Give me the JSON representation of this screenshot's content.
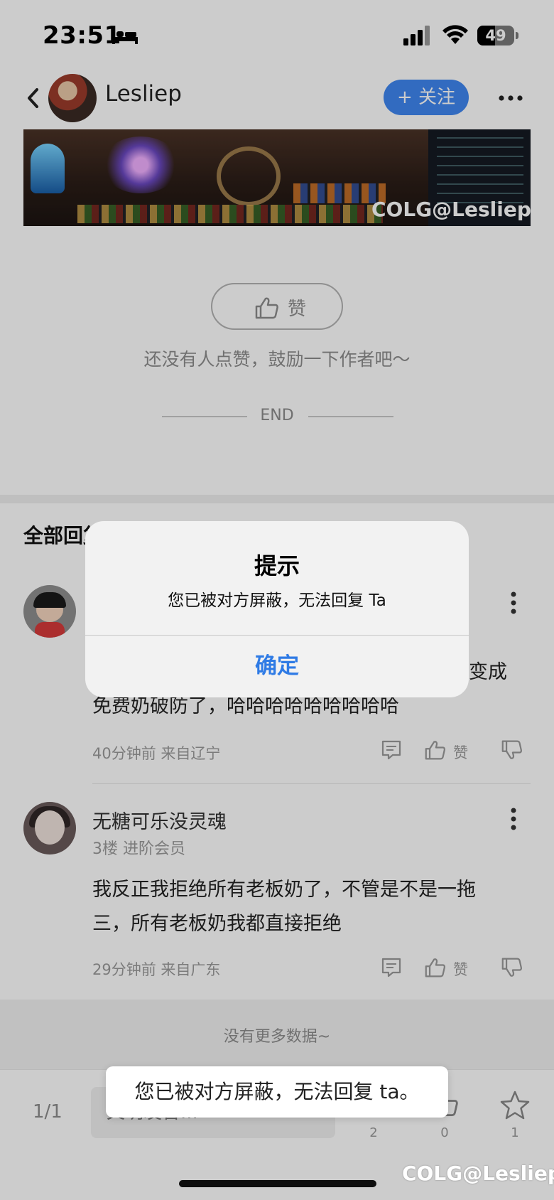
{
  "status_bar": {
    "time": "23:51",
    "battery": "49",
    "battery_level": 0.49
  },
  "nav": {
    "author_name": "Lesliep",
    "follow_label": "+ 关注"
  },
  "banner": {
    "watermark": "COLG@Lesliep"
  },
  "post": {
    "like_label": "赞",
    "like_hint": "还没有人点赞，鼓励一下作者吧～",
    "end_text": "END"
  },
  "comments": {
    "header": "全部回复",
    "items": [
      {
        "text_lines": [
          "变成",
          "免费奶破防了，哈哈哈哈哈哈哈哈哈"
        ],
        "meta": "40分钟前 来自辽宁",
        "like_label": "赞"
      },
      {
        "name": "无糖可乐没灵魂",
        "badge": "3楼 进阶会员",
        "text_lines": [
          "我反正我拒绝所有老板奶了，不管是不是一拖",
          "三，所有老板奶我都直接拒绝"
        ],
        "meta": "29分钟前 来自广东",
        "like_label": "赞"
      }
    ],
    "no_more": "没有更多数据~"
  },
  "bottom_bar": {
    "page_indicator": "1/1",
    "reply_placeholder": "文明发言...",
    "comment_count": "2",
    "like_count": "0",
    "favorite_count": "1"
  },
  "footer_watermark": "COLG@Lesliep",
  "alert": {
    "title": "提示",
    "message": "您已被对方屏蔽，无法回复 Ta",
    "confirm": "确定"
  },
  "toast": {
    "message": "您已被对方屏蔽，无法回复 ta。"
  },
  "colors": {
    "accent": "#3f86f0",
    "alert_button": "#2f7be5",
    "overlay": "rgba(0,0,0,0.2)"
  }
}
